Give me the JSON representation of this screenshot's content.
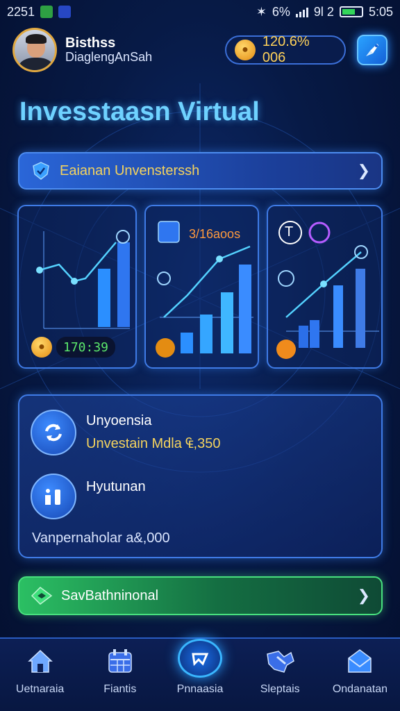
{
  "status_bar": {
    "time": "2251",
    "battery_text": "6%",
    "signal_text": "9l 2",
    "clock": "5:05"
  },
  "header": {
    "user_name": "Bisthss",
    "user_subtitle": "DiaglengAnSah",
    "balance": "120.6% 006"
  },
  "page_title": "Invesstaasn Virtual",
  "banner": {
    "label": "Eaianan Unvensterssh"
  },
  "cards": [
    {
      "value": "170:39"
    },
    {
      "label": "3/16aoos"
    },
    {
      "top_label": "T"
    }
  ],
  "info_panel": {
    "row1_title": "Unyoensia",
    "row1_subtitle": "Unvestain Mdla ₠,350",
    "row2_title": "Hyutunan",
    "footer": "Vanpernaholar a&,000"
  },
  "action_button": {
    "label": "SavBathninonal"
  },
  "bottom_nav": {
    "items": [
      {
        "label": "Uetnaraia",
        "icon": "home-icon"
      },
      {
        "label": "Fiantis",
        "icon": "calendar-icon"
      },
      {
        "label": "Pnnaasia",
        "icon": "center-icon"
      },
      {
        "label": "Sleptais",
        "icon": "puzzle-icon"
      },
      {
        "label": "Ondanatan",
        "icon": "mail-icon"
      }
    ]
  },
  "colors": {
    "accent_blue": "#3f7be6",
    "title_cyan": "#6fd2ff",
    "gold": "#f4d35e",
    "green": "#2bbf63"
  }
}
